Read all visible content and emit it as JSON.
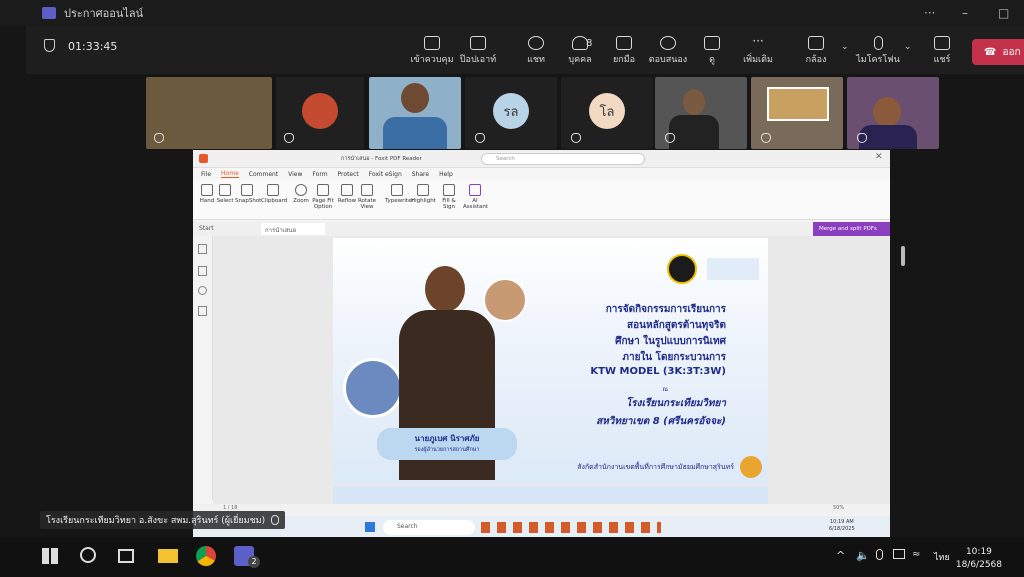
{
  "titlebar": {
    "title": "ประกาศออนไลน์",
    "min_icon": "minimize-icon",
    "max_icon": "maximize-icon",
    "more": "···"
  },
  "meeting": {
    "timer": "01:33:45",
    "participant_count": "8",
    "leave_label": "ออก",
    "buttons": [
      {
        "label": "เข้าควบคุม",
        "icon": "control-icon"
      },
      {
        "label": "ป๊อปเอาท์",
        "icon": "popout-icon"
      },
      {
        "label": "แชท",
        "icon": "chat-icon"
      },
      {
        "label": "บุคคล",
        "icon": "people-icon"
      },
      {
        "label": "ยกมือ",
        "icon": "raise-hand-icon"
      },
      {
        "label": "ตอบสนอง",
        "icon": "react-icon"
      },
      {
        "label": "ดู",
        "icon": "view-icon"
      },
      {
        "label": "เพิ่มเติม",
        "icon": "more-icon"
      },
      {
        "label": "กล้อง",
        "icon": "camera-icon"
      },
      {
        "label": "ไมโครโฟน",
        "icon": "mic-icon"
      },
      {
        "label": "แชร์",
        "icon": "share-icon"
      }
    ],
    "participants": [
      {
        "initials": "",
        "color": "#6b5a3e"
      },
      {
        "initials": "",
        "color": "#c44b2f"
      },
      {
        "initials": "",
        "color": "#8fb0c9"
      },
      {
        "initials": "รล",
        "color": "#b9d3e6"
      },
      {
        "initials": "โล",
        "color": "#f2d9c2"
      },
      {
        "initials": "",
        "color": "#333"
      },
      {
        "initials": "",
        "color": "#7a6a5a"
      },
      {
        "initials": "",
        "color": "#6a4f70"
      }
    ]
  },
  "foxit": {
    "window_title": "การนำเสนอ - Foxit PDF Reader",
    "search_placeholder": "Search",
    "menu": [
      "File",
      "Home",
      "Comment",
      "View",
      "Form",
      "Protect",
      "Foxit eSign",
      "Share",
      "Help"
    ],
    "ribbon": [
      "Hand",
      "Select",
      "SnapShot",
      "Clipboard",
      "Zoom",
      "Page Fit Option",
      "Reflow",
      "Rotate View",
      "Typewriter",
      "Highlight",
      "Fill & Sign",
      "AI Assistant"
    ],
    "tabs": [
      "Start",
      "การนำเสนอ"
    ],
    "merge_label": "Merge and split PDFs",
    "page_indicator": "1 / 18",
    "zoom": "50%"
  },
  "slide": {
    "lines": [
      "การจัดกิจกรรมการเรียนการ",
      "สอนหลักสูตรต้านทุจริต",
      "ศึกษา ในรูปแบบการนิเทศ",
      "ภายใน โดยกระบวนการ",
      "KTW MODEL (3K:3T:3W)"
    ],
    "small": "ณ",
    "school": "โรงเรียนกระเทียมวิทยา",
    "district": "สหวิทยาเขต 8 (ศรีนครอัจจะ)",
    "presenter_name": "นายภูเบศ นิราศภัย",
    "presenter_role": "รองผู้อำนวยการสถานศึกษา",
    "affiliation": "สังกัดสำนักงานเขตพื้นที่การศึกษามัธยมศึกษาสุรินทร์"
  },
  "inner_taskbar": {
    "search": "Search",
    "time": "10:19 AM",
    "date": "6/18/2025"
  },
  "presenter_label": "โรงเรียนกระเทียมวิทยา อ.สังขะ สพม.สุรินทร์ (ผู้เยี่ยมชม)",
  "taskbar": {
    "lang": "ไทย",
    "time": "10:19",
    "date": "18/6/2568",
    "badge": "2"
  }
}
